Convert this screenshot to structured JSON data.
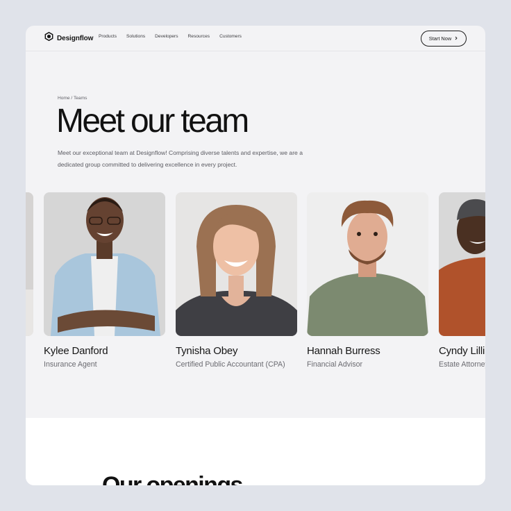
{
  "brand": {
    "name": "Designflow",
    "logo_icon": "hexagon-logo-icon"
  },
  "nav": {
    "links": [
      "Products",
      "Solutions",
      "Developers",
      "Resources",
      "Customers"
    ],
    "cta_label": "Start Now",
    "cta_icon": "chevron-right-icon"
  },
  "hero": {
    "breadcrumb": "Home / Teams",
    "title": "Meet our team",
    "intro": "Meet our exceptional team at Designflow! Comprising diverse talents and expertise, we are a dedicated group committed to delivering excellence in every project."
  },
  "team": [
    {
      "name": "Kylee Danford",
      "role": "Insurance Agent"
    },
    {
      "name": "Tynisha Obey",
      "role": "Certified Public Accountant (CPA)"
    },
    {
      "name": "Hannah Burress",
      "role": "Financial Advisor"
    },
    {
      "name": "Cyndy Lillibridge",
      "role": "Estate Attorney"
    }
  ],
  "openings": {
    "title": "Our openings"
  },
  "colors": {
    "page_bg": "#e0e3ea",
    "frame_bg": "#f3f3f5",
    "text": "#111111",
    "muted": "#6a6a70"
  }
}
